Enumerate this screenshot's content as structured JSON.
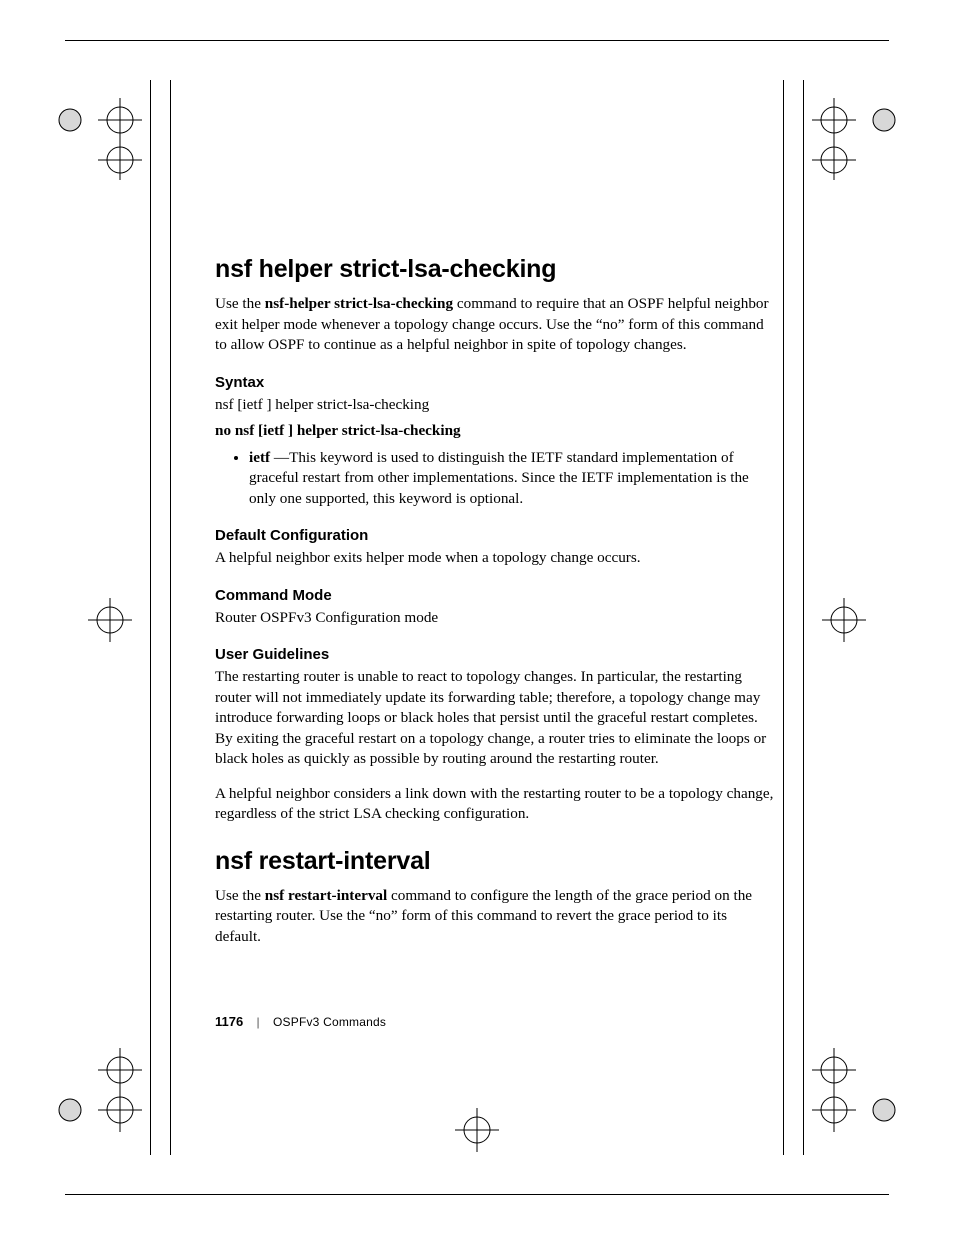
{
  "section1": {
    "title": "nsf helper strict-lsa-checking",
    "intro_pre": "Use the ",
    "intro_bold": "nsf-helper strict-lsa-checking",
    "intro_post": " command to require that an OSPF helpful neighbor exit helper mode whenever a topology change occurs.  Use the “no” form of this command to allow OSPF to continue as a helpful neighbor in spite of topology changes.",
    "syntax_heading": "Syntax",
    "syntax_line": "nsf [ietf ] helper strict-lsa-checking",
    "syntax_no_line": "no nsf [ietf ] helper strict-lsa-checking",
    "bullet_keyword": "ietf",
    "bullet_sep": " —",
    "bullet_text": "This keyword is used to distinguish the IETF standard implementation of graceful restart from other implementations.  Since the IETF implementation is the only one supported, this keyword is optional.",
    "default_heading": "Default Configuration",
    "default_text": "A helpful neighbor exits helper mode when a topology change occurs.",
    "mode_heading": "Command Mode",
    "mode_text": "Router OSPFv3 Configuration mode",
    "guidelines_heading": "User Guidelines",
    "guidelines_p1": "The restarting router is unable to react to topology changes. In particular, the restarting router will not immediately update its forwarding table; therefore, a topology change may introduce forwarding loops or black holes that persist until the graceful restart completes. By exiting the graceful restart on a topology change, a router tries to eliminate the loops or black holes as quickly as possible by routing around the restarting router.",
    "guidelines_p2": "A helpful neighbor considers a link down with the restarting router to be a topology change, regardless of the strict LSA checking configuration."
  },
  "section2": {
    "title": "nsf restart-interval",
    "intro_pre": "Use the ",
    "intro_bold": "nsf restart-interval",
    "intro_post": " command to configure the length of the grace period on the restarting router.  Use the “no” form of this command to revert the grace period to its default."
  },
  "footer": {
    "page_number": "1176",
    "separator": "|",
    "section_name": "OSPFv3 Commands"
  }
}
